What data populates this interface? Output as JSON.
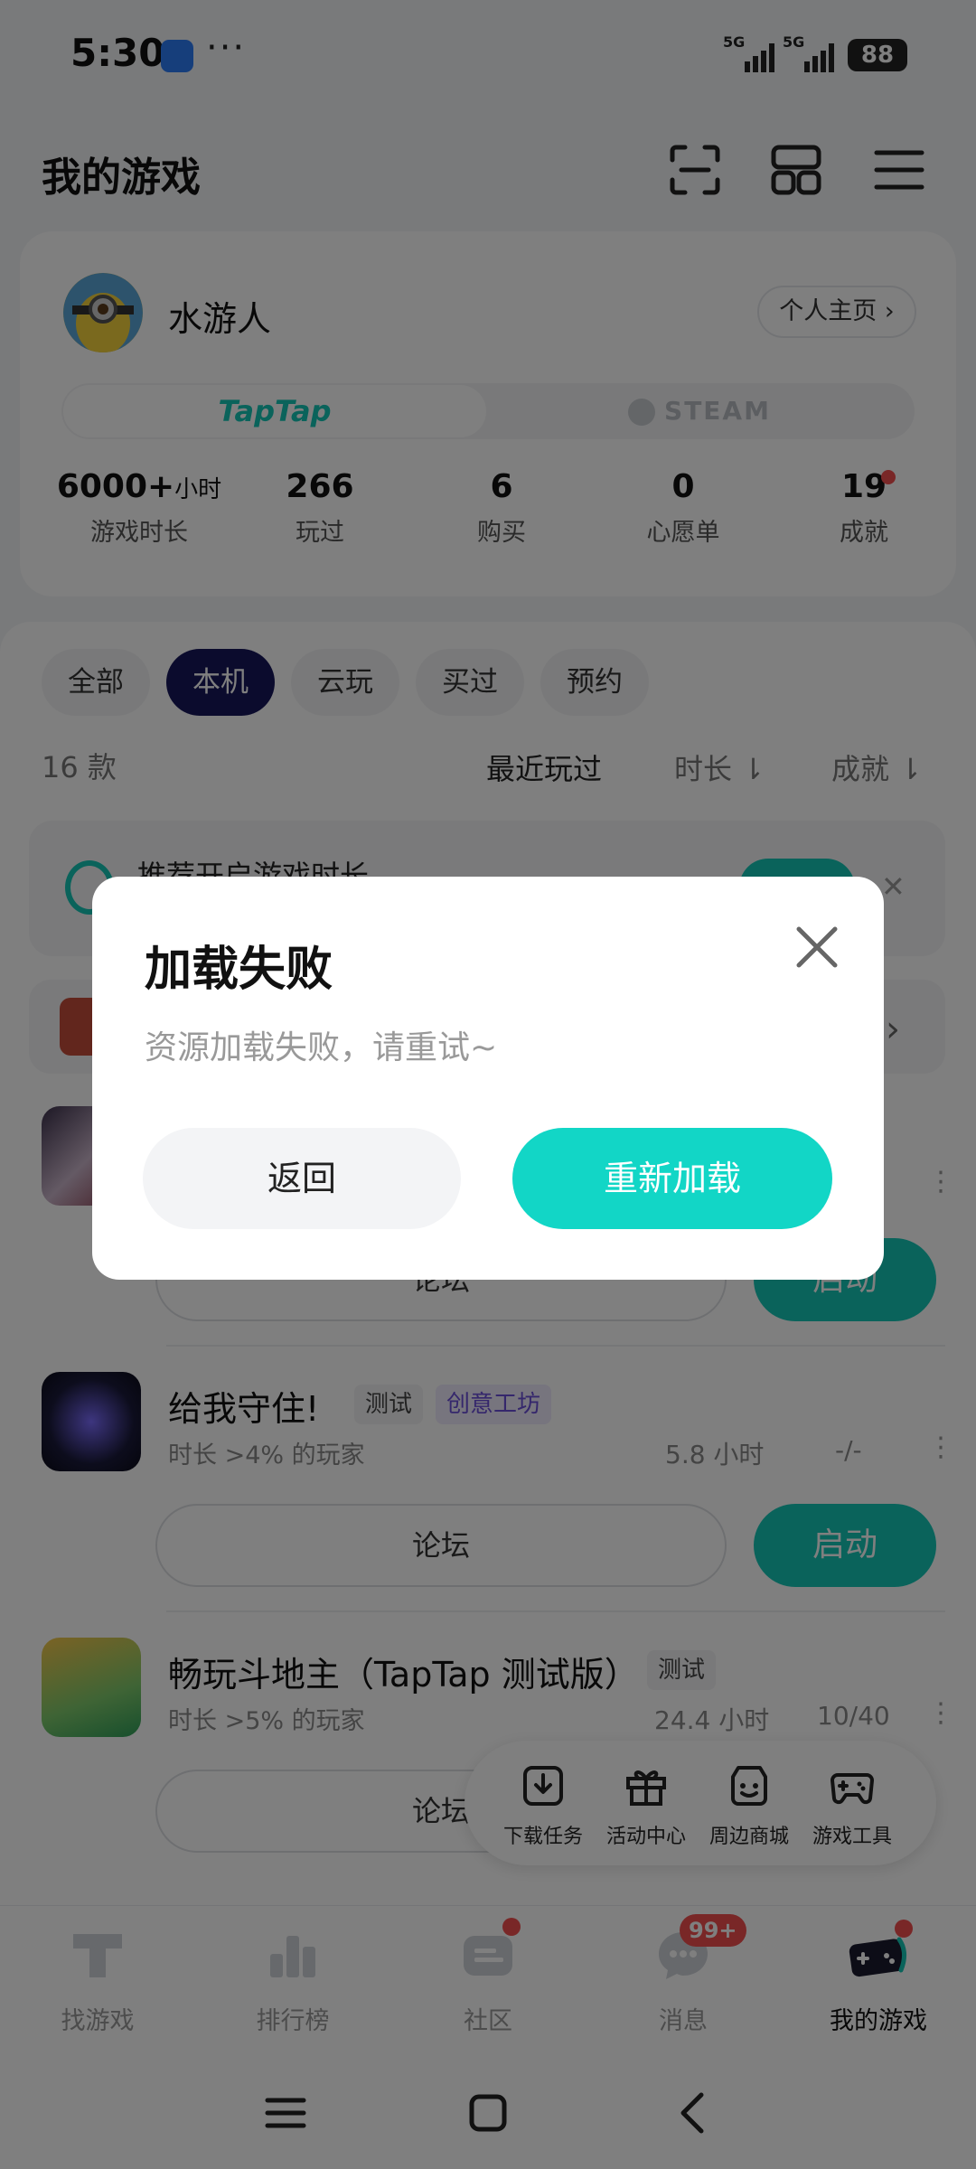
{
  "status_bar": {
    "time": "5:30",
    "more": "···",
    "signal_1": "5G",
    "signal_2": "5G",
    "battery": "88"
  },
  "header": {
    "title": "我的游戏",
    "icons": [
      "scan-icon",
      "grid-icon",
      "menu-icon"
    ]
  },
  "profile": {
    "name": "水游人",
    "home_link": "个人主页 ›",
    "platforms": [
      "TapTap",
      "STEAM"
    ],
    "stats": [
      {
        "value": "6000+",
        "unit": "小时",
        "label": "游戏时长"
      },
      {
        "value": "266",
        "unit": "",
        "label": "玩过"
      },
      {
        "value": "6",
        "unit": "",
        "label": "购买"
      },
      {
        "value": "0",
        "unit": "",
        "label": "心愿单"
      },
      {
        "value": "19",
        "unit": "",
        "label": "成就"
      }
    ]
  },
  "filters": {
    "chips": [
      "全部",
      "本机",
      "云玩",
      "买过",
      "预约"
    ],
    "active": "本机",
    "count": "16 款",
    "sorts": [
      "最近玩过",
      "时长 ⇂",
      "成就 ⇂"
    ]
  },
  "banner": {
    "title": "推荐开启游戏时长"
  },
  "games": [
    {
      "title": "给我守住!",
      "tags": [
        "测试",
        "创意工坊"
      ],
      "subtitle": "时长 >4% 的玩家",
      "hours": "5.8 小时",
      "achievements": "-/-",
      "forum": "论坛",
      "launch": "启动"
    },
    {
      "title": "畅玩斗地主（TapTap 测试版）",
      "tags": [
        "测试"
      ],
      "subtitle": "时长 >5% 的玩家",
      "hours": "24.4 小时",
      "achievements": "10/40",
      "forum": "论坛"
    }
  ],
  "first_game": {
    "forum": "论坛",
    "launch": "启动"
  },
  "float_toolbar": [
    {
      "label": "下载任务",
      "icon": "download-icon"
    },
    {
      "label": "活动中心",
      "icon": "gift-icon"
    },
    {
      "label": "周边商城",
      "icon": "shop-icon"
    },
    {
      "label": "游戏工具",
      "icon": "gamepad-icon"
    }
  ],
  "tabs": [
    {
      "label": "找游戏",
      "icon": "taptap-t-icon"
    },
    {
      "label": "排行榜",
      "icon": "ranking-icon"
    },
    {
      "label": "社区",
      "icon": "community-icon"
    },
    {
      "label": "消息",
      "icon": "message-icon",
      "badge": "99+"
    },
    {
      "label": "我的游戏",
      "icon": "my-games-icon",
      "active": true
    }
  ],
  "dialog": {
    "title": "加载失败",
    "message": "资源加载失败，请重试~",
    "back": "返回",
    "reload": "重新加载"
  },
  "colors": {
    "accent": "#12d6c6",
    "brand_dark": "#16165a",
    "badge": "#f24e4e"
  }
}
